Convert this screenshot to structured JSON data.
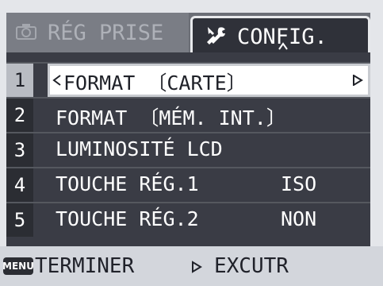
{
  "tabs": [
    {
      "label": "RÉG PRISE",
      "icon": "camera-icon",
      "active": false
    },
    {
      "label": "CONFIG.",
      "icon": "tools-icon",
      "active": true
    }
  ],
  "menu": {
    "items": [
      {
        "number": "1",
        "label": "FORMAT 〔CARTE〕",
        "value": "",
        "selected": true
      },
      {
        "number": "2",
        "label": "FORMAT 〔MÉM. INT.〕",
        "value": ""
      },
      {
        "number": "3",
        "label": "LUMINOSITÉ LCD",
        "value": ""
      },
      {
        "number": "4",
        "label": "TOUCHE RÉG.1",
        "value": "ISO"
      },
      {
        "number": "5",
        "label": "TOUCHE RÉG.2",
        "value": "NON"
      }
    ]
  },
  "footer": {
    "menu_badge": "MENU",
    "finish_label": "TERMINER",
    "exec_label": "EXCUTR"
  },
  "colors": {
    "panel": "#3a3c45",
    "selected_row": "#ffffff",
    "footer": "#d3d6dc"
  }
}
